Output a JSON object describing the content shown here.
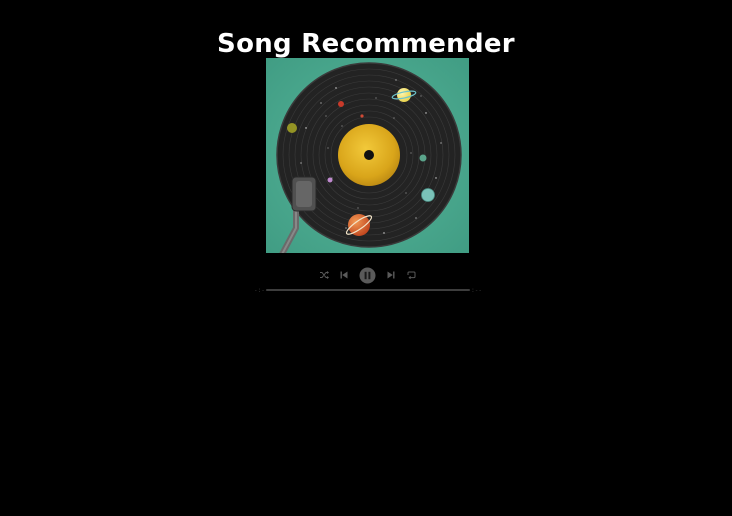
{
  "app": {
    "title": "Song Recommender"
  },
  "player": {
    "album_art": {
      "subject": "vinyl record with planets and stars on teal background"
    },
    "controls": [
      {
        "icon": "shuffle-icon"
      },
      {
        "icon": "previous-track-icon"
      },
      {
        "icon": "pause-icon"
      },
      {
        "icon": "next-track-icon"
      },
      {
        "icon": "repeat-icon"
      }
    ],
    "progress": {
      "current_time": "-:--",
      "total_time": "-:--",
      "fraction": 0
    }
  },
  "colors": {
    "background": "#000000",
    "title": "#ffffff",
    "album_bg": "#4fae93",
    "record": "#1c1c1c",
    "label": "#e0b21f",
    "controls": "#5a5a5a",
    "track": "#3d3d3d"
  }
}
